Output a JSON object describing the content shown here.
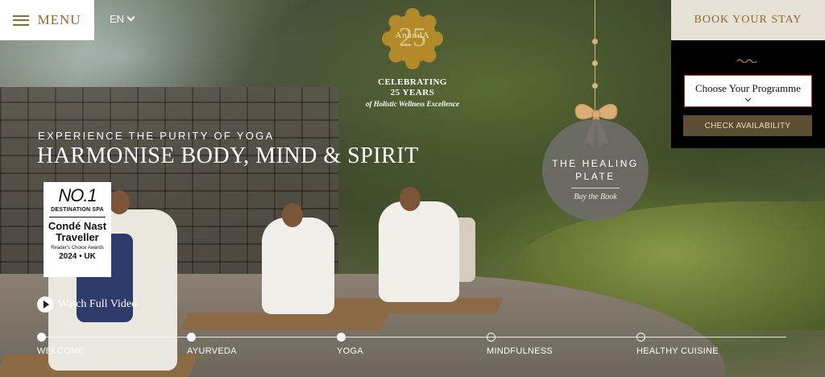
{
  "header": {
    "menu_label": "MENU",
    "language": "EN"
  },
  "logo": {
    "name": "AnandA",
    "number": "25",
    "celebrating_line1": "CELEBRATING",
    "celebrating_line2": "25 YEARS",
    "celebrating_tagline": "of Holistic Wellness Excellence"
  },
  "hero": {
    "kicker": "EXPERIENCE THE PURITY OF YOGA",
    "headline": "HARMONISE BODY, MIND & SPIRIT",
    "watch_video": "Watch Full Video"
  },
  "badge": {
    "rank": "NO.1",
    "category": "DESTINATION SPA",
    "brand_line1": "Condé Nast",
    "brand_line2": "Traveller",
    "award": "Reader's Choice Awards",
    "year_region": "2024 • UK"
  },
  "promo": {
    "title_line1": "THE HEALING",
    "title_line2": "PLATE",
    "cta": "Buy the Book"
  },
  "booking": {
    "header": "BOOK YOUR STAY",
    "programme_select": "Choose Your Programme",
    "check_button": "CHECK AVAILABILITY"
  },
  "timeline": {
    "items": [
      {
        "label": "WELCOME",
        "filled": true
      },
      {
        "label": "AYURVEDA",
        "filled": true
      },
      {
        "label": "YOGA",
        "filled": true
      },
      {
        "label": "MINDFULNESS",
        "filled": false
      },
      {
        "label": "HEALTHY CUISINE",
        "filled": false
      }
    ]
  },
  "colors": {
    "gold": "#8a6c33",
    "panel_beige": "#e8e2d6",
    "button_brown": "#5d4d33",
    "logo_gold": "#b38a2a"
  }
}
